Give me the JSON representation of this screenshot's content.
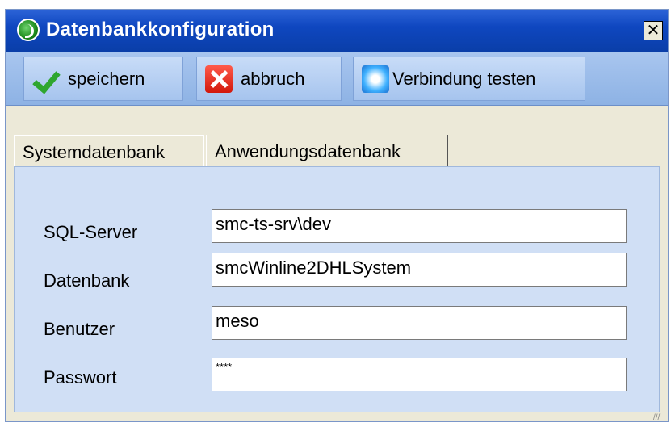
{
  "window": {
    "title": "Datenbankkonfiguration",
    "close_label": "✕"
  },
  "toolbar": {
    "save_label": "speichern",
    "cancel_label": "abbruch",
    "test_label": "Verbindung testen"
  },
  "tabs": [
    {
      "label": "Systemdatenbank",
      "active": true
    },
    {
      "label": "Anwendungsdatenbank",
      "active": false
    }
  ],
  "form": {
    "server_label": "SQL-Server",
    "server_value": "smc-ts-srv\\dev",
    "database_label": "Datenbank",
    "database_value": "smcWinline2DHLSystem",
    "user_label": "Benutzer",
    "user_value": "meso",
    "password_label": "Passwort",
    "password_value": "****"
  },
  "colors": {
    "titlebar": "#0f47c0",
    "toolbar": "#a9c6ef",
    "panel": "#d0dff5"
  }
}
